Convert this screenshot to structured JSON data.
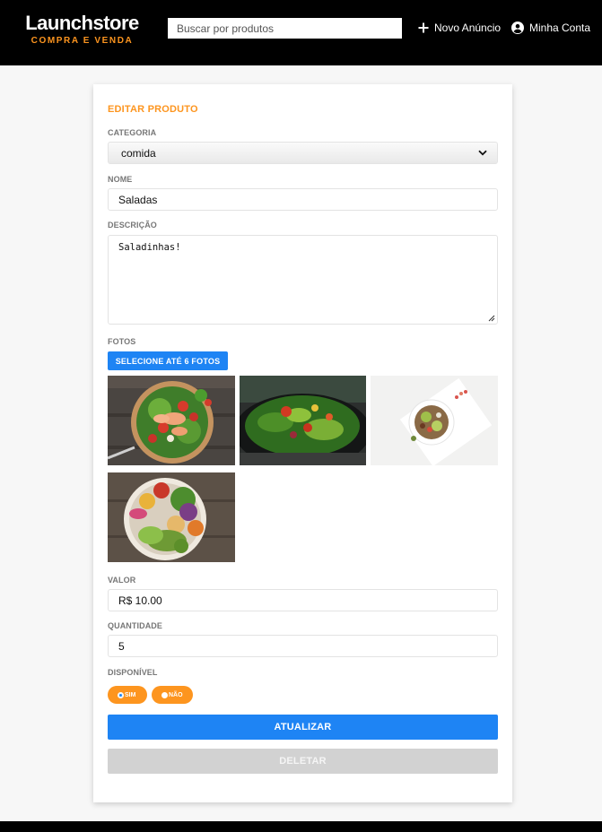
{
  "header": {
    "logo_title": "Launchstore",
    "logo_subtitle": "COMPRA E VENDA",
    "search_placeholder": "Buscar por produtos",
    "new_ad_label": "Novo Anúncio",
    "account_label": "Minha Conta"
  },
  "form": {
    "heading": "EDITAR PRODUTO",
    "category": {
      "label": "CATEGORIA",
      "value": "comida"
    },
    "name": {
      "label": "NOME",
      "value": "Saladas"
    },
    "description": {
      "label": "DESCRIÇÃO",
      "value": "Saladinhas!"
    },
    "photos": {
      "label": "FOTOS",
      "button_label": "SELECIONE ATÉ 6 FOTOS",
      "items": [
        "salad-shrimp-bowl",
        "salad-dark-plate",
        "salad-white-bowl",
        "salad-buddha-bowl"
      ]
    },
    "price": {
      "label": "VALOR",
      "value": "R$ 10.00"
    },
    "quantity": {
      "label": "QUANTIDADE",
      "value": "5"
    },
    "available": {
      "label": "DISPONÍVEL",
      "yes_label": "SIM",
      "no_label": "NÃO",
      "selected": "SIM"
    },
    "update_label": "ATUALIZAR",
    "delete_label": "DELETAR"
  },
  "colors": {
    "accent": "#fd951f",
    "primary": "#1e84f4",
    "header_bg": "#000000"
  },
  "icons": {
    "plus": "plus-icon",
    "account": "account-circle-icon",
    "dropdown": "chevron-down-icon"
  }
}
